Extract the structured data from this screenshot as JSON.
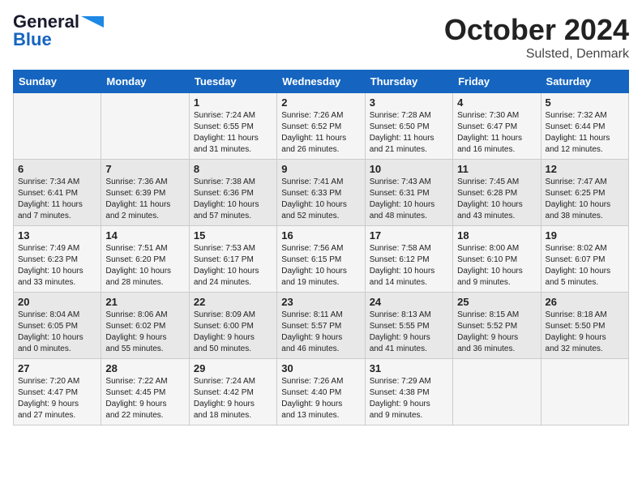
{
  "header": {
    "logo_general": "General",
    "logo_blue": "Blue",
    "month": "October 2024",
    "location": "Sulsted, Denmark"
  },
  "weekdays": [
    "Sunday",
    "Monday",
    "Tuesday",
    "Wednesday",
    "Thursday",
    "Friday",
    "Saturday"
  ],
  "weeks": [
    [
      {
        "day": "",
        "info": ""
      },
      {
        "day": "",
        "info": ""
      },
      {
        "day": "1",
        "info": "Sunrise: 7:24 AM\nSunset: 6:55 PM\nDaylight: 11 hours\nand 31 minutes."
      },
      {
        "day": "2",
        "info": "Sunrise: 7:26 AM\nSunset: 6:52 PM\nDaylight: 11 hours\nand 26 minutes."
      },
      {
        "day": "3",
        "info": "Sunrise: 7:28 AM\nSunset: 6:50 PM\nDaylight: 11 hours\nand 21 minutes."
      },
      {
        "day": "4",
        "info": "Sunrise: 7:30 AM\nSunset: 6:47 PM\nDaylight: 11 hours\nand 16 minutes."
      },
      {
        "day": "5",
        "info": "Sunrise: 7:32 AM\nSunset: 6:44 PM\nDaylight: 11 hours\nand 12 minutes."
      }
    ],
    [
      {
        "day": "6",
        "info": "Sunrise: 7:34 AM\nSunset: 6:41 PM\nDaylight: 11 hours\nand 7 minutes."
      },
      {
        "day": "7",
        "info": "Sunrise: 7:36 AM\nSunset: 6:39 PM\nDaylight: 11 hours\nand 2 minutes."
      },
      {
        "day": "8",
        "info": "Sunrise: 7:38 AM\nSunset: 6:36 PM\nDaylight: 10 hours\nand 57 minutes."
      },
      {
        "day": "9",
        "info": "Sunrise: 7:41 AM\nSunset: 6:33 PM\nDaylight: 10 hours\nand 52 minutes."
      },
      {
        "day": "10",
        "info": "Sunrise: 7:43 AM\nSunset: 6:31 PM\nDaylight: 10 hours\nand 48 minutes."
      },
      {
        "day": "11",
        "info": "Sunrise: 7:45 AM\nSunset: 6:28 PM\nDaylight: 10 hours\nand 43 minutes."
      },
      {
        "day": "12",
        "info": "Sunrise: 7:47 AM\nSunset: 6:25 PM\nDaylight: 10 hours\nand 38 minutes."
      }
    ],
    [
      {
        "day": "13",
        "info": "Sunrise: 7:49 AM\nSunset: 6:23 PM\nDaylight: 10 hours\nand 33 minutes."
      },
      {
        "day": "14",
        "info": "Sunrise: 7:51 AM\nSunset: 6:20 PM\nDaylight: 10 hours\nand 28 minutes."
      },
      {
        "day": "15",
        "info": "Sunrise: 7:53 AM\nSunset: 6:17 PM\nDaylight: 10 hours\nand 24 minutes."
      },
      {
        "day": "16",
        "info": "Sunrise: 7:56 AM\nSunset: 6:15 PM\nDaylight: 10 hours\nand 19 minutes."
      },
      {
        "day": "17",
        "info": "Sunrise: 7:58 AM\nSunset: 6:12 PM\nDaylight: 10 hours\nand 14 minutes."
      },
      {
        "day": "18",
        "info": "Sunrise: 8:00 AM\nSunset: 6:10 PM\nDaylight: 10 hours\nand 9 minutes."
      },
      {
        "day": "19",
        "info": "Sunrise: 8:02 AM\nSunset: 6:07 PM\nDaylight: 10 hours\nand 5 minutes."
      }
    ],
    [
      {
        "day": "20",
        "info": "Sunrise: 8:04 AM\nSunset: 6:05 PM\nDaylight: 10 hours\nand 0 minutes."
      },
      {
        "day": "21",
        "info": "Sunrise: 8:06 AM\nSunset: 6:02 PM\nDaylight: 9 hours\nand 55 minutes."
      },
      {
        "day": "22",
        "info": "Sunrise: 8:09 AM\nSunset: 6:00 PM\nDaylight: 9 hours\nand 50 minutes."
      },
      {
        "day": "23",
        "info": "Sunrise: 8:11 AM\nSunset: 5:57 PM\nDaylight: 9 hours\nand 46 minutes."
      },
      {
        "day": "24",
        "info": "Sunrise: 8:13 AM\nSunset: 5:55 PM\nDaylight: 9 hours\nand 41 minutes."
      },
      {
        "day": "25",
        "info": "Sunrise: 8:15 AM\nSunset: 5:52 PM\nDaylight: 9 hours\nand 36 minutes."
      },
      {
        "day": "26",
        "info": "Sunrise: 8:18 AM\nSunset: 5:50 PM\nDaylight: 9 hours\nand 32 minutes."
      }
    ],
    [
      {
        "day": "27",
        "info": "Sunrise: 7:20 AM\nSunset: 4:47 PM\nDaylight: 9 hours\nand 27 minutes."
      },
      {
        "day": "28",
        "info": "Sunrise: 7:22 AM\nSunset: 4:45 PM\nDaylight: 9 hours\nand 22 minutes."
      },
      {
        "day": "29",
        "info": "Sunrise: 7:24 AM\nSunset: 4:42 PM\nDaylight: 9 hours\nand 18 minutes."
      },
      {
        "day": "30",
        "info": "Sunrise: 7:26 AM\nSunset: 4:40 PM\nDaylight: 9 hours\nand 13 minutes."
      },
      {
        "day": "31",
        "info": "Sunrise: 7:29 AM\nSunset: 4:38 PM\nDaylight: 9 hours\nand 9 minutes."
      },
      {
        "day": "",
        "info": ""
      },
      {
        "day": "",
        "info": ""
      }
    ]
  ]
}
